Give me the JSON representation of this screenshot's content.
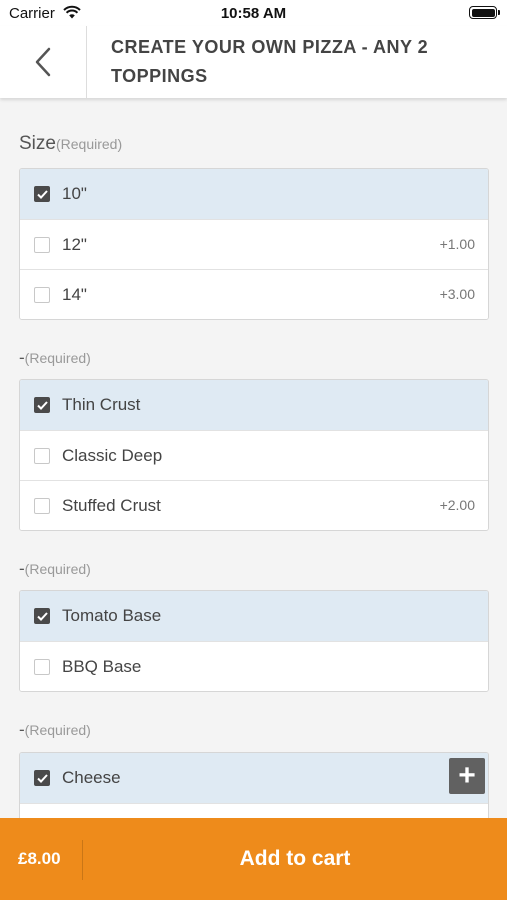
{
  "status_bar": {
    "carrier": "Carrier",
    "time": "10:58 AM"
  },
  "header": {
    "title": "CREATE YOUR OWN PIZZA - ANY 2 TOPPINGS"
  },
  "colors": {
    "accent": "#ee8b1b",
    "selected_row": "#dfeaf3",
    "checkbox_checked": "#4a4a4a"
  },
  "sections": [
    {
      "title": "Size",
      "required": "(Required)",
      "options": [
        {
          "label": "10\"",
          "price": "",
          "checked": true
        },
        {
          "label": "12\"",
          "price": "+1.00",
          "checked": false
        },
        {
          "label": "14\"",
          "price": "+3.00",
          "checked": false
        }
      ]
    },
    {
      "title": "-",
      "required": "(Required)",
      "options": [
        {
          "label": "Thin Crust",
          "price": "",
          "checked": true
        },
        {
          "label": "Classic Deep",
          "price": "",
          "checked": false
        },
        {
          "label": "Stuffed Crust",
          "price": "+2.00",
          "checked": false
        }
      ]
    },
    {
      "title": "-",
      "required": "(Required)",
      "options": [
        {
          "label": "Tomato Base",
          "price": "",
          "checked": true
        },
        {
          "label": "BBQ Base",
          "price": "",
          "checked": false
        }
      ]
    },
    {
      "title": "-",
      "required": "(Required)",
      "options": [
        {
          "label": "Cheese",
          "price": "",
          "checked": true,
          "action_icon": "plus-icon"
        }
      ]
    }
  ],
  "cart": {
    "total": "£8.00",
    "button_label": "Add to cart"
  }
}
